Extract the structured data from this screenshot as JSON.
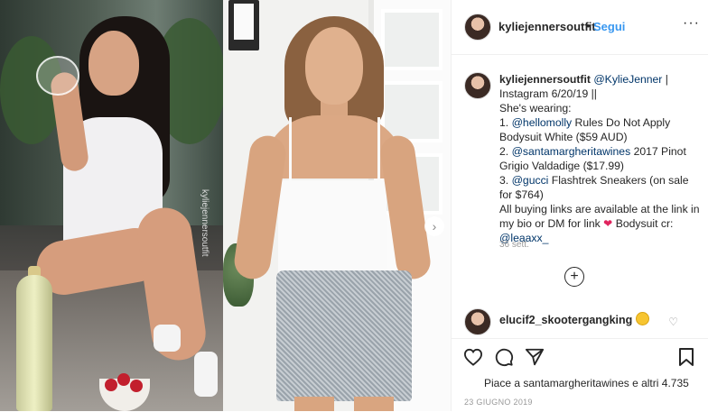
{
  "left_photo": {
    "watermark": "kyliejennersoutfit"
  },
  "header": {
    "username": "kyliejennersoutfit",
    "separator": "•",
    "follow_label": "Segui",
    "more_label": "···"
  },
  "caption": {
    "username": "kyliejennersoutfit",
    "line1_link": "@KylieJenner",
    "line1_rest": "| Instagram 6/20/19 ||",
    "wearing": "She's wearing:",
    "item1_num": "1.",
    "item1_link": "@hellomolly",
    "item1_text": "Rules Do Not Apply Bodysuit White ($59 AUD)",
    "item2_num": "2.",
    "item2_link": "@santamargheritawines",
    "item2_text": "2017 Pinot Grigio Valdadige ($17.99)",
    "item3_num": "3.",
    "item3_link": "@gucci",
    "item3_text": "Flashtrek Sneakers (on sale for $764)",
    "links_text": "All buying links are available at the link in my bio or DM for link",
    "heart": "❤",
    "credit_text": "Bodysuit cr:",
    "credit_link": "@leaaxx_",
    "time_ago": "36 sett."
  },
  "load_more": "+",
  "comment": {
    "username": "elucif2_skootergangking",
    "like_icon": "♡"
  },
  "actions": {
    "icons": [
      "heart-icon",
      "comment-icon",
      "share-icon",
      "bookmark-icon"
    ],
    "likes_text": "Piace a santamargheritawines e altri 4.735",
    "date": "23 GIUGNO 2019"
  }
}
